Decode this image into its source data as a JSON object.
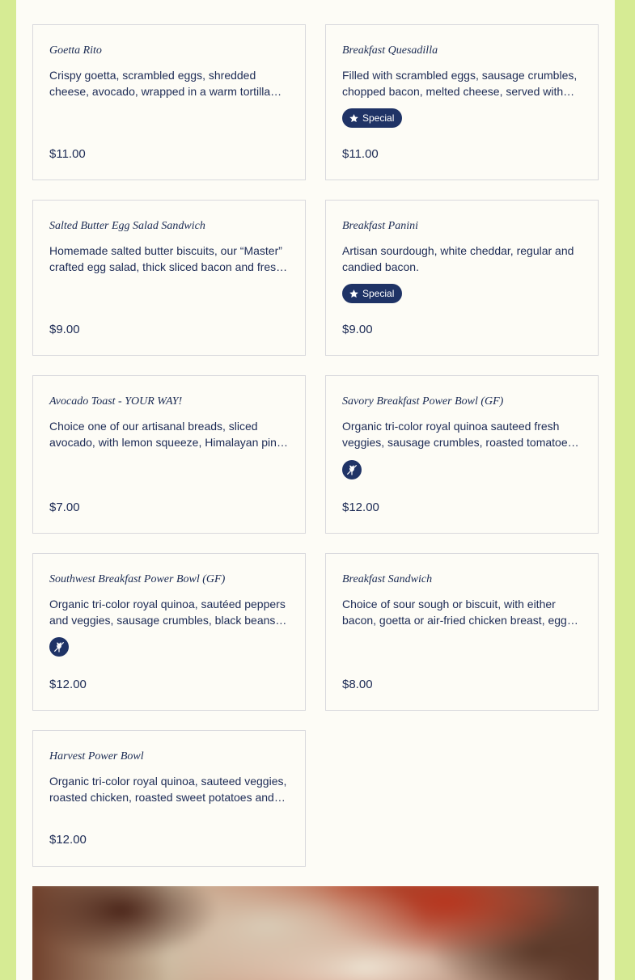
{
  "menu": {
    "items": [
      {
        "title": "Goetta Rito",
        "description": "Crispy goetta, scrambled eggs, shredded cheese, avocado, wrapped in a warm tortilla served with salsa.",
        "price": "$11.00"
      },
      {
        "title": "Breakfast Quesadilla",
        "description": "Filled with scrambled eggs, sausage crumbles, chopped bacon, melted cheese, served with salsa and sour cream.",
        "badge": "Special",
        "price": "$11.00"
      },
      {
        "title": "Salted Butter Egg Salad Sandwich",
        "description": "Homemade salted butter biscuits, our “Master” crafted egg salad, thick sliced bacon and fresh greens.",
        "price": "$9.00"
      },
      {
        "title": "Breakfast Panini",
        "description": "Artisan sourdough, white cheddar, regular and candied bacon.",
        "badge": "Special",
        "price": "$9.00"
      },
      {
        "title": "Avocado Toast - YOUR WAY!",
        "description": "Choice one of our artisanal breads, sliced avocado, with lemon squeeze, Himalayan pink salt and cracked pepper.",
        "price": "$7.00"
      },
      {
        "title": "Savory Breakfast Power Bowl (GF)",
        "description": "Organic tri-color royal quinoa sauteed fresh veggies, sausage crumbles, roasted tomatoes and a fried egg.",
        "diet_icon": "gluten-free-icon",
        "price": "$12.00"
      },
      {
        "title": "Southwest Breakfast Power Bowl (GF)",
        "description": "Organic tri-color royal quinoa, sautéed peppers and veggies, sausage crumbles, black beans and salsa.",
        "diet_icon": "gluten-free-icon",
        "price": "$12.00"
      },
      {
        "title": "Breakfast Sandwich",
        "description": "Choice of sour sough or biscuit, with either bacon, goetta or air-fried chicken breast, egg and cheese.",
        "price": "$8.00"
      },
      {
        "title": "Harvest Power Bowl",
        "description": "Organic tri-color royal quinoa, sauteed veggies, roasted chicken, roasted sweet potatoes and greens.",
        "price": "$12.00"
      }
    ]
  },
  "colors": {
    "page_background": "#d6eb94",
    "panel_background": "#fdfcf6",
    "accent": "#1f3366",
    "text": "#1d2b55",
    "card_border": "#d9d9dd"
  },
  "icons": {
    "badge_icon": "star-icon",
    "diet_icon": "gluten-free-icon"
  }
}
